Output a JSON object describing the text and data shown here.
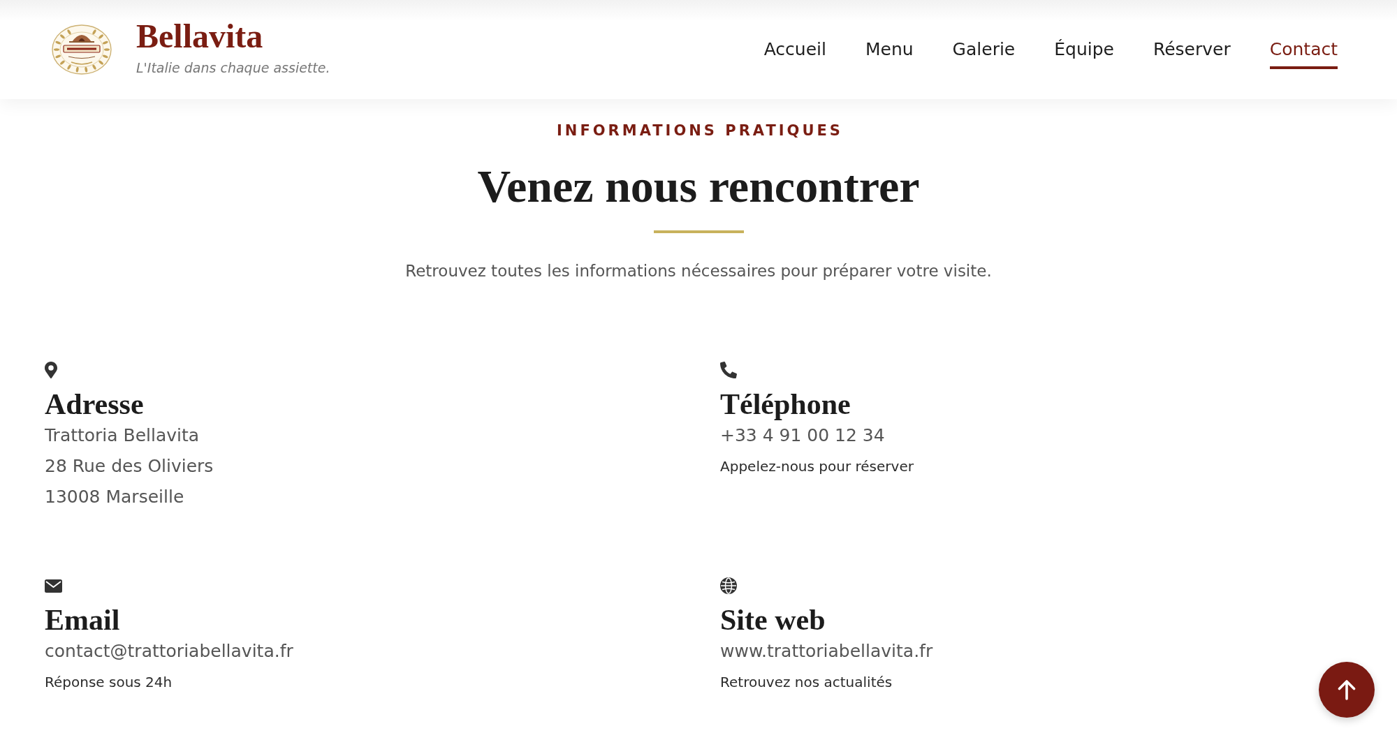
{
  "header": {
    "brand": {
      "name": "Bellavita",
      "tagline": "L'Italie dans chaque assiette."
    },
    "nav": [
      {
        "label": "Accueil",
        "selected": false
      },
      {
        "label": "Menu",
        "selected": false
      },
      {
        "label": "Galerie",
        "selected": false
      },
      {
        "label": "Équipe",
        "selected": false
      },
      {
        "label": "Réserver",
        "selected": false
      },
      {
        "label": "Contact",
        "selected": true
      }
    ]
  },
  "section": {
    "eyebrow": "INFORMATIONS PRATIQUES",
    "title": "Venez nous rencontrer",
    "subtitle": "Retrouvez toutes les informations nécessaires pour préparer votre visite."
  },
  "contact_cards": [
    {
      "kind": "address",
      "title": "Adresse",
      "lines": [
        "Trattoria Bellavita",
        "28 Rue des Oliviers",
        "13008 Marseille"
      ]
    },
    {
      "kind": "phone",
      "title": "Téléphone",
      "lines": [
        "+33 4 91 00 12 34"
      ],
      "note": "Appelez-nous pour réserver"
    },
    {
      "kind": "email",
      "title": "Email",
      "lines": [
        "contact@trattoriabellavita.fr"
      ],
      "note": "Réponse sous 24h"
    },
    {
      "kind": "website",
      "title": "Site web",
      "lines": [
        "www.trattoriabellavita.fr"
      ],
      "note": "Retrouvez nos actualités"
    }
  ]
}
